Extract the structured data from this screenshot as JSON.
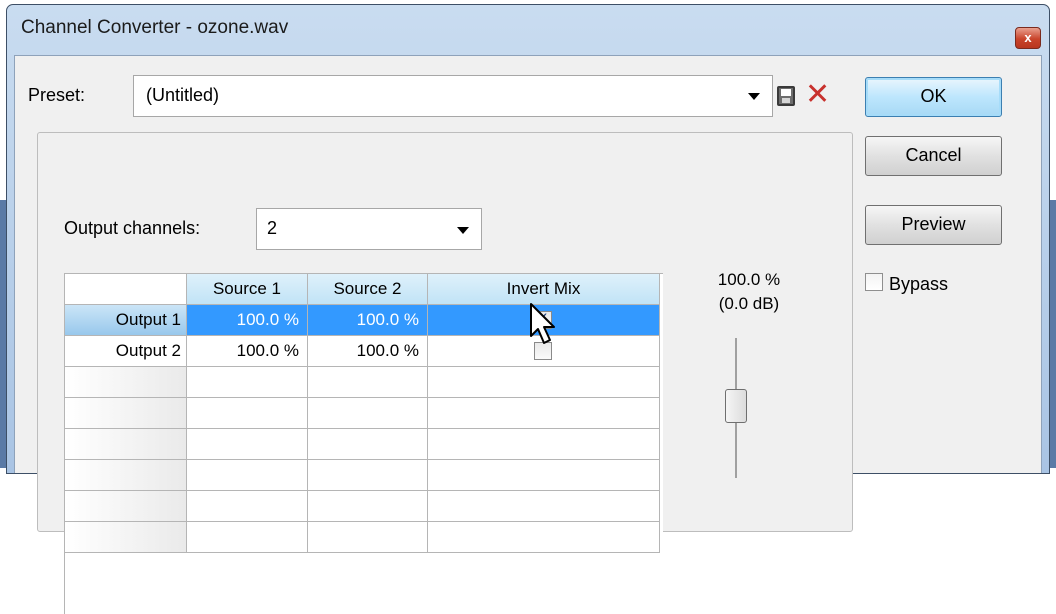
{
  "window": {
    "title": "Channel Converter - ozone.wav",
    "close_glyph": "x"
  },
  "preset": {
    "label": "Preset:",
    "value": "(Untitled)"
  },
  "buttons": {
    "ok": "OK",
    "cancel": "Cancel",
    "preview": "Preview"
  },
  "bypass": {
    "label": "Bypass",
    "checked": false
  },
  "output_channels": {
    "label": "Output channels:",
    "value": "2"
  },
  "grid": {
    "headers": [
      "",
      "Source 1",
      "Source 2",
      "Invert Mix"
    ],
    "rows": [
      {
        "label": "Output 1",
        "source1": "100.0 %",
        "source2": "100.0 %",
        "invert": true,
        "selected": true
      },
      {
        "label": "Output 2",
        "source1": "100.0 %",
        "source2": "100.0 %",
        "invert": false,
        "selected": false
      }
    ]
  },
  "level": {
    "percent": "100.0 %",
    "db": "(0.0 dB)"
  },
  "icons": {
    "save": "save-icon",
    "delete": "delete-icon",
    "dropdown": "chevron-down-icon"
  }
}
